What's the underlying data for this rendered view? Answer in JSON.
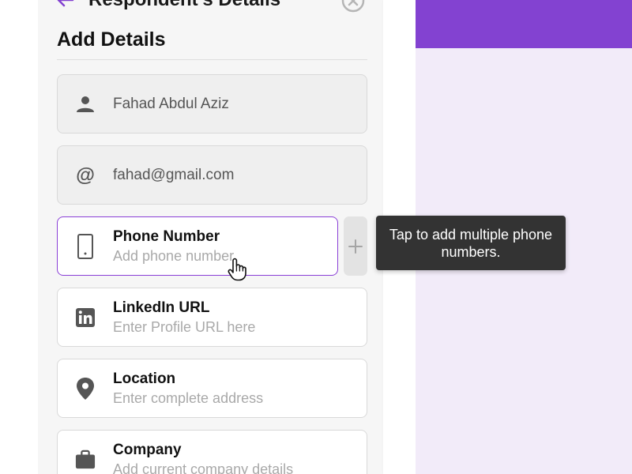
{
  "header": {
    "title": "Respondent's Details",
    "back_icon": "arrow-left-icon",
    "close_icon": "close-circle-icon"
  },
  "section": {
    "title": "Add Details"
  },
  "fields": [
    {
      "icon": "person-icon",
      "value": "Fahad Abdul Aziz"
    },
    {
      "icon": "at-sign-icon",
      "value": "fahad@gmail.com"
    },
    {
      "icon": "phone-icon",
      "label": "Phone Number",
      "placeholder": "Add phone number"
    },
    {
      "icon": "linkedin-icon",
      "label": "LinkedIn URL",
      "placeholder": "Enter Profile URL here"
    },
    {
      "icon": "location-pin-icon",
      "label": "Location",
      "placeholder": "Enter complete address"
    },
    {
      "icon": "briefcase-icon",
      "label": "Company",
      "placeholder": "Add current company details"
    }
  ],
  "add_button": {
    "symbol": "+"
  },
  "tooltip": {
    "text": "Tap to add multiple phone numbers."
  },
  "colors": {
    "accent": "#8342d1",
    "active_border": "#8a3fd6",
    "background": "#f2ebf9",
    "tooltip_bg": "#333333"
  }
}
